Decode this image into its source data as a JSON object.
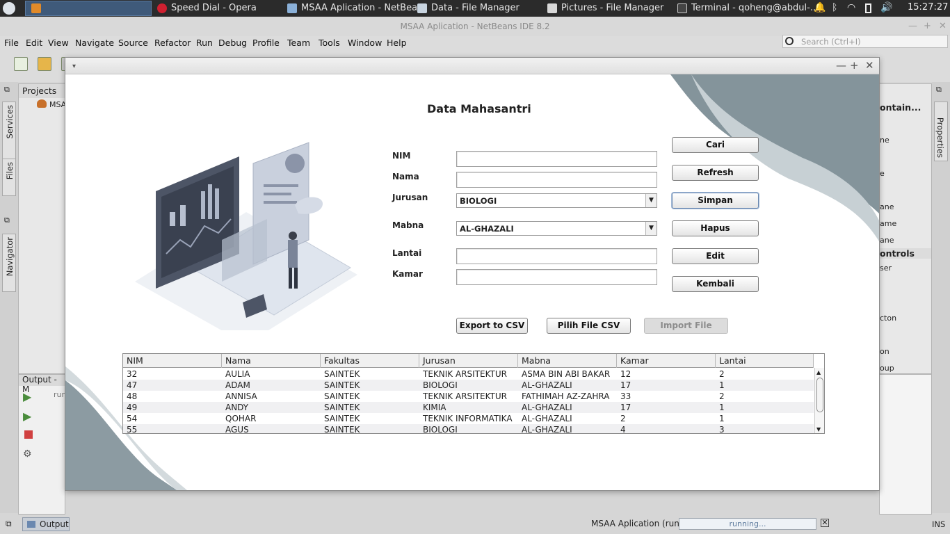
{
  "taskbar": {
    "tasks": [
      {
        "label": "Speed Dial - Opera",
        "icon": "opera-icon"
      },
      {
        "label": "MSAA Aplication - NetBea...",
        "icon": "netbeans-icon"
      },
      {
        "label": "Data - File Manager",
        "icon": "folder-icon"
      },
      {
        "label": "Pictures - File Manager",
        "icon": "image-folder-icon"
      },
      {
        "label": "Terminal - qoheng@abdul-...",
        "icon": "terminal-icon"
      }
    ],
    "tray_icons": [
      "bell-icon",
      "bluetooth-icon",
      "wifi-icon",
      "battery-icon",
      "volume-icon"
    ],
    "clock": "15:27:27"
  },
  "ide": {
    "title": "MSAA Aplication - NetBeans IDE 8.2",
    "menu": [
      "File",
      "Edit",
      "View",
      "Navigate",
      "Source",
      "Refactor",
      "Run",
      "Debug",
      "Profile",
      "Team",
      "Tools",
      "Window",
      "Help"
    ],
    "search_placeholder": "Search (Ctrl+I)",
    "left_tabs": [
      "Services",
      "Files",
      "Navigator"
    ],
    "right_tabs": [
      "Properties"
    ],
    "projects_tab": "Projects",
    "project_root": "MSA",
    "output_tab": "Output - M",
    "output_text": "run",
    "palette_items": [
      "ontain...",
      "ne",
      "e",
      "ane",
      "ame",
      "ane",
      "ontrols",
      "ser",
      "cton",
      "on",
      "oup"
    ],
    "status": {
      "output_tab": "Output",
      "run_label": "MSAA Aplication (run)",
      "progress_text": "running...",
      "ins": "INS"
    }
  },
  "app": {
    "title": "Data Mahasantri",
    "fields": {
      "nim": {
        "label": "NIM",
        "value": ""
      },
      "nama": {
        "label": "Nama",
        "value": ""
      },
      "jurusan": {
        "label": "Jurusan",
        "value": "BIOLOGI"
      },
      "mabna": {
        "label": "Mabna",
        "value": "AL-GHAZALI"
      },
      "lantai": {
        "label": "Lantai",
        "value": ""
      },
      "kamar": {
        "label": "Kamar",
        "value": ""
      }
    },
    "buttons": {
      "cari": "Cari",
      "refresh": "Refresh",
      "simpan": "Simpan",
      "hapus": "Hapus",
      "edit": "Edit",
      "kembali": "Kembali",
      "export_csv": "Export to CSV",
      "pilih_csv": "Pilih File CSV",
      "import_file": "Import File"
    },
    "table": {
      "columns": [
        "NIM",
        "Nama",
        "Fakultas",
        "Jurusan",
        "Mabna",
        "Kamar",
        "Lantai"
      ],
      "rows": [
        [
          "32",
          "AULIA",
          "SAINTEK",
          "TEKNIK ARSITEKTUR",
          "ASMA BIN ABI BAKAR",
          "12",
          "2"
        ],
        [
          "47",
          "ADAM",
          "SAINTEK",
          "BIOLOGI",
          "AL-GHAZALI",
          "17",
          "1"
        ],
        [
          "48",
          "ANNISA",
          "SAINTEK",
          "TEKNIK ARSITEKTUR",
          "FATHIMAH AZ-ZAHRA",
          "33",
          "2"
        ],
        [
          "49",
          "ANDY",
          "SAINTEK",
          "KIMIA",
          "AL-GHAZALI",
          "17",
          "1"
        ],
        [
          "54",
          "QOHAR",
          "SAINTEK",
          "TEKNIK INFORMATIKA",
          "AL-GHAZALI",
          "2",
          "1"
        ],
        [
          "55",
          "AGUS",
          "SAINTEK",
          "BIOLOGI",
          "AL-GHAZALI",
          "4",
          "3"
        ]
      ]
    },
    "colors": {
      "accent_gray": "#7b8f98",
      "blob_dark": "#8c9ba2"
    }
  }
}
